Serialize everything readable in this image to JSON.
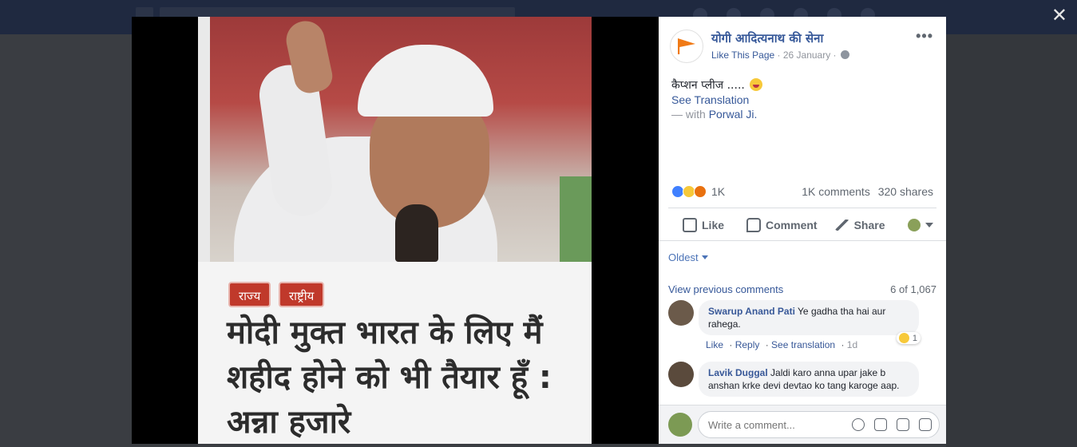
{
  "photo": {
    "tags": [
      "राज्य",
      "राष्ट्रीय"
    ],
    "headline": "मोदी मुक्त भारत के लिए मैं शहीद होने को भी तैयार हूँ : अन्ना हजारे"
  },
  "post": {
    "page_name": "योगी आदित्यनाथ की सेना",
    "like_page": "Like This Page",
    "date": "· 26 January ·",
    "more": "•••",
    "caption": "कैप्शन प्लीज .....",
    "see_translation": "See Translation",
    "with_prefix": "— with",
    "tagged_name": "Porwal Ji.",
    "reaction_count": "1K",
    "comments_count": "1K comments",
    "shares_count": "320 shares"
  },
  "actions": {
    "like": "Like",
    "comment": "Comment",
    "share": "Share"
  },
  "comments_section": {
    "sort": "Oldest",
    "view_previous": "View previous comments",
    "position": "6 of 1,067",
    "items": [
      {
        "author": "Swarup Anand Pati",
        "text": "Ye gadha tha hai aur rahega.",
        "like": "Like",
        "reply": "Reply",
        "translate": "See translation",
        "time": "1d",
        "reaction_count": "1"
      },
      {
        "author": "Lavik Duggal",
        "text": "Jaldi karo anna upar jake b anshan krke devi devtao ko tang karoge aap."
      }
    ],
    "composer_placeholder": "Write a comment..."
  },
  "close": "✕",
  "colors": {
    "link_blue": "#365899",
    "tag_red": "#c0392b",
    "panel_bg": "#ffffff",
    "overlay_bg": "#3a3d42"
  }
}
